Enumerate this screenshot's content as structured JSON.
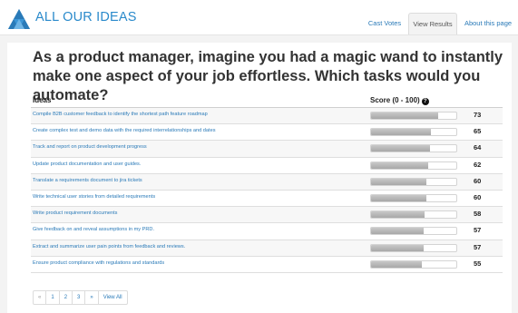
{
  "brand": {
    "name": "ALL OUR IDEAS",
    "color": "#2a8acb"
  },
  "nav": {
    "items": [
      {
        "label": "Cast Votes",
        "active": false
      },
      {
        "label": "View Results",
        "active": true
      },
      {
        "label": "About this page",
        "active": false
      }
    ]
  },
  "main": {
    "question": "As a product manager, imagine you had a magic wand to instantly make one aspect of your job effortless. Which tasks would you automate?",
    "table": {
      "headers": {
        "ideas": "Ideas",
        "score": "Score (0 - 100)"
      },
      "rows": [
        {
          "idea": "Compile B2B customer feedback to identify the shortest path feature roadmap",
          "score": 73
        },
        {
          "idea": "Create complex test and demo data with the required interrelationships and dates",
          "score": 65
        },
        {
          "idea": "Track and report on product development progress",
          "score": 64
        },
        {
          "idea": "Update product documentation and user guides.",
          "score": 62
        },
        {
          "idea": "Translate a requirements document to jira tickets",
          "score": 60
        },
        {
          "idea": "Write technical user stories from detailed requirements",
          "score": 60
        },
        {
          "idea": "Write product requirement documents",
          "score": 58
        },
        {
          "idea": "Give feedback on and reveal assumptions in my PRD.",
          "score": 57
        },
        {
          "idea": "Extract and summarize user pain points from feedback and reviews.",
          "score": 57
        },
        {
          "idea": "Ensure product compliance with regulations and standards",
          "score": 55
        }
      ]
    },
    "pagination": {
      "prev": "«",
      "pages": [
        "1",
        "2",
        "3"
      ],
      "next": "»",
      "view_all": "View All"
    }
  },
  "icons": {
    "logo": "triangle-logo-icon",
    "help": "question-circle-icon"
  },
  "colors": {
    "link": "#2a7ab8",
    "bar": "#b5b5b5"
  }
}
